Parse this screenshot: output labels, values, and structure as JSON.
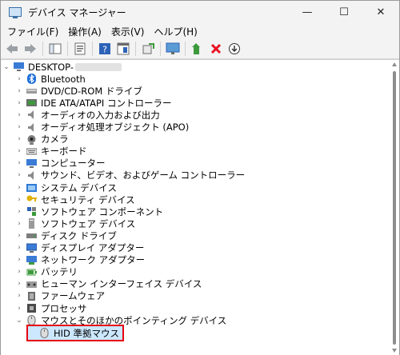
{
  "window": {
    "title": "デバイス マネージャー",
    "minimize": "—",
    "maximize": "☐",
    "close": "✕"
  },
  "menubar": [
    "ファイル(F)",
    "操作(A)",
    "表示(V)",
    "ヘルプ(H)"
  ],
  "tree": {
    "root": "DESKTOP-",
    "categories": [
      {
        "label": "Bluetooth",
        "icon": "bluetooth-icon"
      },
      {
        "label": "DVD/CD-ROM ドライブ",
        "icon": "dvd-drive-icon"
      },
      {
        "label": "IDE ATA/ATAPI コントローラー",
        "icon": "ide-controller-icon"
      },
      {
        "label": "オーディオの入力および出力",
        "icon": "speaker-icon"
      },
      {
        "label": "オーディオ処理オブジェクト (APO)",
        "icon": "speaker-icon"
      },
      {
        "label": "カメラ",
        "icon": "camera-icon"
      },
      {
        "label": "キーボード",
        "icon": "keyboard-icon"
      },
      {
        "label": "コンピューター",
        "icon": "computer-icon"
      },
      {
        "label": "サウンド、ビデオ、およびゲーム コントローラー",
        "icon": "speaker-icon"
      },
      {
        "label": "システム デバイス",
        "icon": "system-folder-icon"
      },
      {
        "label": "セキュリティ デバイス",
        "icon": "security-key-icon"
      },
      {
        "label": "ソフトウェア コンポーネント",
        "icon": "software-component-icon"
      },
      {
        "label": "ソフトウェア デバイス",
        "icon": "software-device-icon"
      },
      {
        "label": "ディスク ドライブ",
        "icon": "disk-drive-icon"
      },
      {
        "label": "ディスプレイ アダプター",
        "icon": "display-adapter-icon"
      },
      {
        "label": "ネットワーク アダプター",
        "icon": "network-adapter-icon"
      },
      {
        "label": "バッテリ",
        "icon": "battery-icon"
      },
      {
        "label": "ヒューマン インターフェイス デバイス",
        "icon": "hid-icon"
      },
      {
        "label": "ファームウェア",
        "icon": "firmware-icon"
      },
      {
        "label": "プロセッサ",
        "icon": "processor-icon"
      },
      {
        "label": "マウスとそのほかのポインティング デバイス",
        "icon": "mouse-icon",
        "expanded": true
      }
    ],
    "child": {
      "label": "HID 準拠マウス",
      "icon": "mouse-icon"
    }
  },
  "colors": {
    "highlight_border": "#e60012",
    "selection_bg": "#cce8ff"
  }
}
